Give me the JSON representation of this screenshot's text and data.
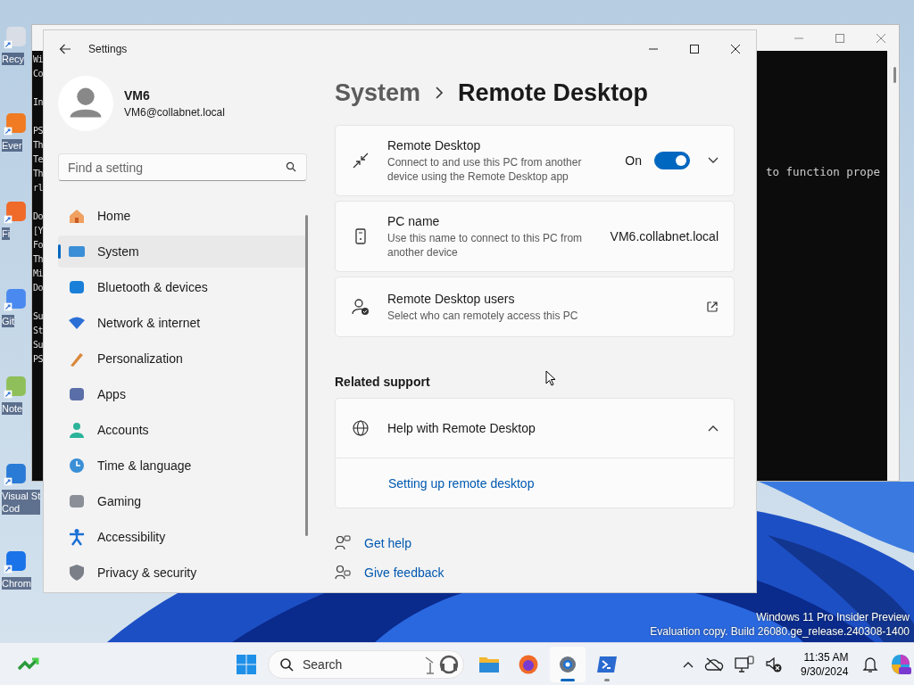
{
  "desktop": {
    "icons": [
      {
        "label": "Recy"
      },
      {
        "label": "Ever"
      },
      {
        "label": "Fi"
      },
      {
        "label": "Git"
      },
      {
        "label": "Note"
      },
      {
        "label": "Visual St\nCod"
      },
      {
        "label": "Chrom"
      }
    ],
    "build_info": [
      "Windows 11 Pro Insider Preview",
      "Evaluation copy. Build 26080.ge_release.240308-1400"
    ]
  },
  "terminal": {
    "left_blocks": [
      [
        "Wi",
        "Co"
      ],
      [
        "In"
      ],
      [
        "PS",
        "Th",
        "Te",
        "Th",
        "rl"
      ],
      [
        "Do",
        "[Y",
        "Fo",
        "Th",
        "Mi",
        "Do"
      ],
      [
        "Su",
        "St",
        "Su",
        "PS"
      ]
    ],
    "right_text": "to function prope"
  },
  "settings": {
    "title": "Settings",
    "account": {
      "name": "VM6",
      "email": "VM6@collabnet.local"
    },
    "search": {
      "placeholder": "Find a setting"
    },
    "nav": [
      {
        "label": "Home",
        "selected": false
      },
      {
        "label": "System",
        "selected": true
      },
      {
        "label": "Bluetooth & devices",
        "selected": false
      },
      {
        "label": "Network & internet",
        "selected": false
      },
      {
        "label": "Personalization",
        "selected": false
      },
      {
        "label": "Apps",
        "selected": false
      },
      {
        "label": "Accounts",
        "selected": false
      },
      {
        "label": "Time & language",
        "selected": false
      },
      {
        "label": "Gaming",
        "selected": false
      },
      {
        "label": "Accessibility",
        "selected": false
      },
      {
        "label": "Privacy & security",
        "selected": false
      }
    ],
    "breadcrumb": [
      "System",
      "Remote Desktop"
    ],
    "cards": [
      {
        "kind": "toggle",
        "title": "Remote Desktop",
        "description": "Connect to and use this PC from another device using the Remote Desktop app",
        "state_label": "On",
        "on": true
      },
      {
        "kind": "value",
        "title": "PC name",
        "description": "Use this name to connect to this PC from another device",
        "value": "VM6.collabnet.local"
      },
      {
        "kind": "link",
        "title": "Remote Desktop users",
        "description": "Select who can remotely access this PC"
      }
    ],
    "related": {
      "heading": "Related support",
      "title": "Help with Remote Desktop",
      "expanded": true,
      "links": [
        "Setting up remote desktop"
      ]
    },
    "footer_links": [
      "Get help",
      "Give feedback"
    ]
  },
  "taskbar": {
    "search_placeholder": "Search",
    "apps": [
      {
        "selected": false,
        "running": false
      },
      {
        "selected": false,
        "running": false
      },
      {
        "selected": true,
        "running": true
      },
      {
        "selected": false,
        "running": true
      }
    ],
    "time": "11:35 AM",
    "date": "9/30/2024"
  }
}
